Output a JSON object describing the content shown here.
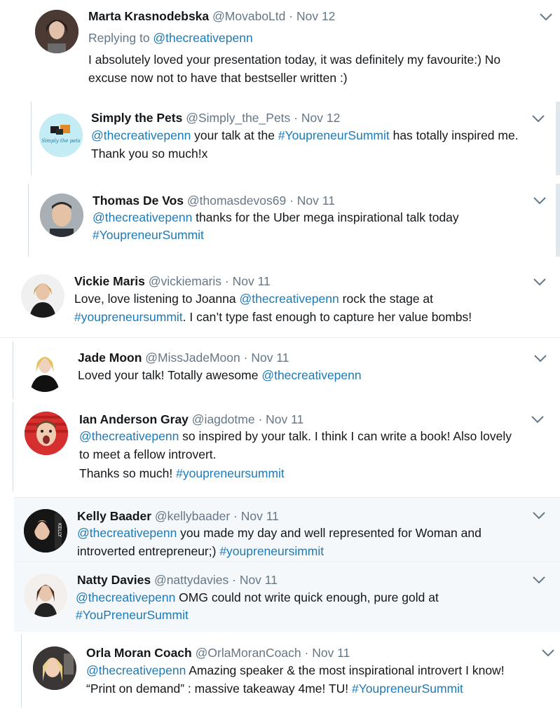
{
  "colors": {
    "link": "#1b7ab8",
    "meta": "#657786",
    "text": "#14171a",
    "shaded_bg": "#f5f8fa"
  },
  "icons": {
    "more": "chevron-down-icon"
  },
  "tweets": [
    {
      "name": "Marta Krasnodebska",
      "handle": "@MovaboLtd",
      "dot": "·",
      "date": "Nov 12",
      "reply_prefix": "Replying to ",
      "reply_to": "@thecreativepenn",
      "line1": "I absolutely loved your presentation today, it was definitely my favourite:) No",
      "line2": "excuse now not to have that bestseller written :)"
    },
    {
      "name": "Simply the Pets",
      "handle": "@Simply_the_Pets",
      "dot": "·",
      "date": "Nov 12",
      "avatar_text": "Simply the pets",
      "l1_mention": "@thecreativepenn",
      "l1_text": " your talk at the ",
      "l1_tag": "#YoupreneurSummit",
      "l1_end": " has totally inspired me.",
      "line2": "Thank you so much!x"
    },
    {
      "name": "Thomas De Vos",
      "handle": "@thomasdevos69",
      "dot": "·",
      "date": "Nov 11",
      "l1_mention": "@thecreativepenn",
      "l1_text": " thanks for the Uber mega inspirational talk today",
      "l2_tag": "#YoupreneurSummit"
    },
    {
      "name": "Vickie Maris",
      "handle": "@vickiemaris",
      "dot": "·",
      "date": "Nov 11",
      "l1_text": "Love, love listening to Joanna ",
      "l1_mention": "@thecreativepenn",
      "l1_end": " rock the stage at",
      "l2_tag": "#youpreneursummit",
      "l2_text": ". I can’t type fast enough to capture her value bombs!"
    },
    {
      "name": "Jade Moon",
      "handle": "@MissJadeMoon",
      "dot": "·",
      "date": "Nov 11",
      "l1_text": "Loved your talk! Totally awesome ",
      "l1_mention": "@thecreativepenn"
    },
    {
      "name": "Ian Anderson Gray",
      "handle": "@iagdotme",
      "dot": "·",
      "date": "Nov 11",
      "l1_mention": "@thecreativepenn",
      "l1_text": " so inspired by your talk. I think I can write a book! Also lovely",
      "line2": "to meet a fellow introvert.",
      "l3_text": "Thanks so much! ",
      "l3_tag": "#youpreneursummit"
    },
    {
      "name": "Kelly Baader",
      "handle": "@kellybaader",
      "dot": "·",
      "date": "Nov 11",
      "avatar_text": "KELLY",
      "l1_mention": "@thecreativepenn",
      "l1_text": " you made my day and well represented for Woman and",
      "l2_text": "introverted entrepreneur;) ",
      "l2_tag": "#youpreneursimmit"
    },
    {
      "name": "Natty Davies",
      "handle": "@nattydavies",
      "dot": "·",
      "date": "Nov 11",
      "l1_mention": "@thecreativepenn",
      "l1_text": " OMG could not write quick enough, pure gold at",
      "l2_tag": "#YouPreneurSummit"
    },
    {
      "name": "Orla Moran Coach",
      "handle": "@OrlaMoranCoach",
      "dot": "·",
      "date": "Nov 11",
      "l1_mention": "@thecreativepenn",
      "l1_text": " Amazing speaker & the most inspirational introvert I know!",
      "l2_text": "“Print on demand” : massive takeaway 4me! TU! ",
      "l2_tag": "#YoupreneurSummit"
    }
  ]
}
